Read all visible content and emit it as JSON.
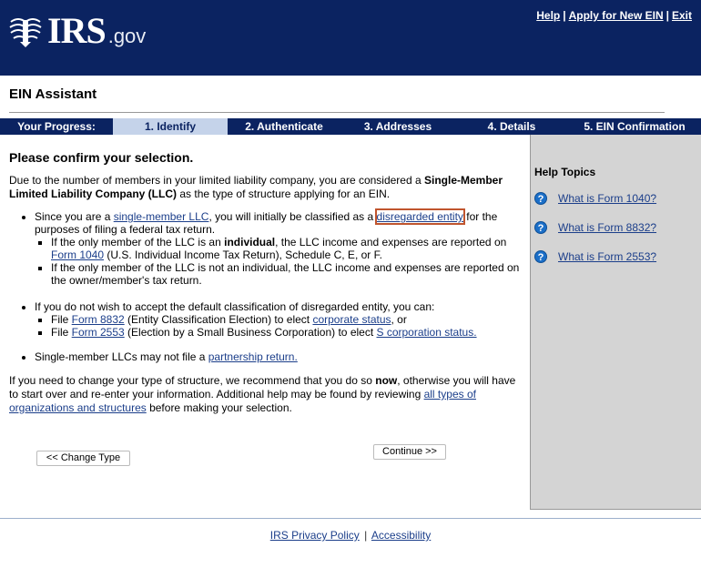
{
  "header": {
    "logo_irs": "IRS",
    "logo_gov": ".gov",
    "links": [
      "Help",
      "Apply for New EIN",
      "Exit"
    ],
    "bg_color": "#0b2361"
  },
  "app": {
    "title": "EIN Assistant"
  },
  "progress": {
    "label": "Your Progress:",
    "steps": [
      "1. Identify",
      "2. Authenticate",
      "3. Addresses",
      "4. Details",
      "5. EIN Confirmation"
    ],
    "active_index": 0
  },
  "main": {
    "heading": "Please confirm your selection.",
    "intro": {
      "pre": "Due to the number of members in your limited liability company, you are considered a ",
      "bold": "Single-Member Limited Liability Company (LLC)",
      "post": " as the type of structure applying for an EIN."
    },
    "bullet1": {
      "pre": "Since you are a ",
      "link1": "single-member LLC",
      "mid": ", you will initially be classified as a ",
      "link2": "disregarded entity",
      "post": " for the purposes of filing a federal tax return.",
      "sub1": {
        "pre": "If the only member of the LLC is an ",
        "bold": "individual",
        "mid": ", the LLC income and expenses are reported on ",
        "link": "Form 1040",
        "post": " (U.S. Individual Income Tax Return), Schedule C, E, or F."
      },
      "sub2": "If the only member of the LLC is not an individual, the LLC income and expenses are reported on the owner/member's tax return."
    },
    "bullet2": {
      "text": "If you do not wish to accept the default classification of disregarded entity, you can:",
      "sub1": {
        "pre": "File ",
        "link": "Form 8832",
        "mid": " (Entity Classification Election) to elect ",
        "link2": "corporate status",
        "post": ", or"
      },
      "sub2": {
        "pre": "File ",
        "link": "Form 2553",
        "mid": " (Election by a Small Business Corporation) to elect ",
        "link2": "S corporation status."
      }
    },
    "bullet3": {
      "pre": "Single-member LLCs may not file a ",
      "link": "partnership return."
    },
    "closing": {
      "pre": "If you need to change your type of structure, we recommend that you do so ",
      "bold": "now",
      "mid": ", otherwise you will have to start over and re-enter your information.  Additional help may be found by reviewing ",
      "link": "all types of organizations and structures",
      "post": " before making your selection."
    },
    "buttons": {
      "change_type": "<< Change Type",
      "continue": "Continue >>"
    }
  },
  "sidebar": {
    "title": "Help Topics",
    "items": [
      "What is Form 1040?",
      "What is Form 8832?",
      "What is Form 2553?"
    ],
    "icon": "help-question-icon"
  },
  "footer": {
    "links": [
      "IRS Privacy Policy",
      "Accessibility"
    ],
    "separator": "|"
  }
}
